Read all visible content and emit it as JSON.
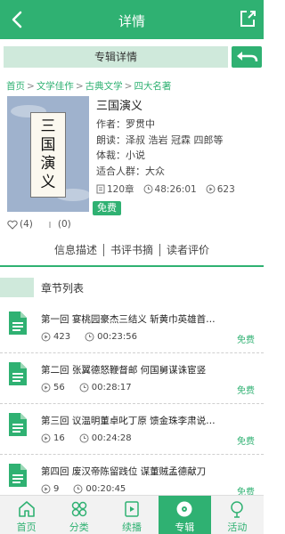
{
  "colors": {
    "accent": "#2fb172",
    "accent_light": "#cfe9db"
  },
  "header": {
    "title": "详情",
    "back_icon": "chevron-left-icon",
    "share_icon": "share-icon"
  },
  "subheader": {
    "title": "专辑详情",
    "return_icon": "return-arrow-icon"
  },
  "breadcrumb": [
    "首页",
    "文学佳作",
    "古典文学",
    "四大名著"
  ],
  "book": {
    "cover_text": [
      "三",
      "国",
      "演",
      "义"
    ],
    "title": "三国演义",
    "author": "作者：罗贯中",
    "narrator": "朗读：泽叔 浩岩 冠霖 四郎等",
    "genre": "体裁：小说",
    "audience": "适合人群：大众",
    "chapters": "120章",
    "duration": "48:26:01",
    "plays": "623",
    "free_badge": "免费"
  },
  "actions": {
    "likes": "(4)",
    "comments": "(0)"
  },
  "tabs": [
    "信息描述",
    "书评书摘",
    "读者评价"
  ],
  "section_title": "章节列表",
  "chapters": [
    {
      "title": "第一回 宴桃园豪杰三结义 斩黄巾英雄首…",
      "plays": "423",
      "duration": "00:23:56",
      "price": "免费"
    },
    {
      "title": "第二回 张翼德怒鞭督邮 何国舅谋诛宦竖",
      "plays": "56",
      "duration": "00:28:17",
      "price": "免费"
    },
    {
      "title": "第三回 议温明董卓叱丁原 馈金珠李肃说…",
      "plays": "16",
      "duration": "00:24:28",
      "price": "免费"
    },
    {
      "title": "第四回 废汉帝陈留践位 谋董贼孟德献刀",
      "plays": "9",
      "duration": "00:20:45",
      "price": "免费"
    }
  ],
  "bottom_nav": [
    {
      "label": "首页",
      "icon": "home-icon"
    },
    {
      "label": "分类",
      "icon": "category-icon"
    },
    {
      "label": "续播",
      "icon": "resume-icon"
    },
    {
      "label": "专辑",
      "icon": "album-disc-icon",
      "active": true
    },
    {
      "label": "活动",
      "icon": "activity-icon"
    }
  ]
}
